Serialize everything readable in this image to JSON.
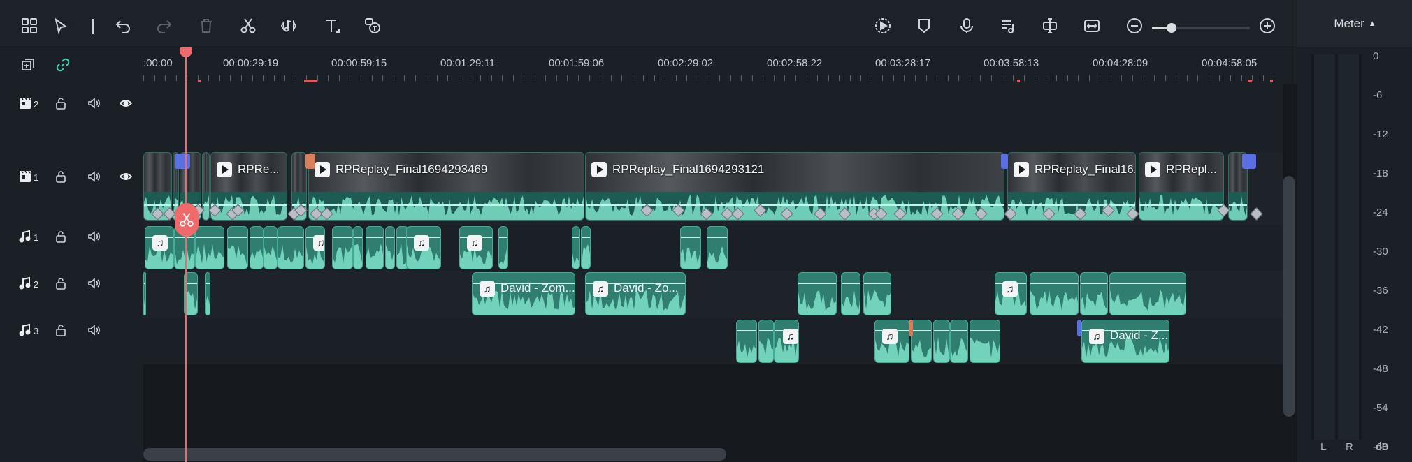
{
  "toolbar": {
    "left_icons": [
      "layout-icon",
      "select-arrow-icon",
      "undo-icon",
      "redo-icon",
      "delete-icon",
      "scissors-icon",
      "audio-beat-icon",
      "text-icon",
      "speech-to-text-icon"
    ],
    "right_icons": [
      "render-preview-icon",
      "marker-icon",
      "microphone-icon",
      "audio-mixer-icon",
      "split-icon",
      "fit-timeline-icon",
      "zoom-out-icon",
      "zoom-in-icon"
    ],
    "zoom_level": 0.2
  },
  "meter": {
    "title": "Meter",
    "scale": [
      "0",
      "-6",
      "-12",
      "-18",
      "-24",
      "-30",
      "-36",
      "-42",
      "-48",
      "-54",
      "-60"
    ],
    "unit": "dB",
    "channels": [
      "L",
      "R"
    ]
  },
  "ruler": {
    "labels": [
      ":00:00",
      "00:00:29:19",
      "00:00:59:15",
      "00:01:29:11",
      "00:01:59:06",
      "00:02:29:02",
      "00:02:58:22",
      "00:03:28:17",
      "00:03:58:13",
      "00:04:28:09",
      "00:04:58:05"
    ]
  },
  "tracks": {
    "video": [
      {
        "number": "2",
        "kind": "video"
      },
      {
        "number": "1",
        "kind": "video"
      }
    ],
    "audio": [
      {
        "number": "1",
        "kind": "audio"
      },
      {
        "number": "2",
        "kind": "audio"
      },
      {
        "number": "3",
        "kind": "audio"
      }
    ]
  },
  "clips": {
    "video1": [
      {
        "title": "RPRe..."
      },
      {
        "title": "RPReplay_Final1694293469"
      },
      {
        "title": "RPReplay_Final1694293121"
      },
      {
        "title": "RPReplay_Final16..."
      },
      {
        "title": "RPRepl..."
      }
    ],
    "audio2": [
      {
        "title": "David - Zom..."
      },
      {
        "title": "David - Zo..."
      }
    ],
    "audio3": [
      {
        "title": "David - Z..."
      }
    ]
  },
  "colors": {
    "playhead": "#f06a6b",
    "clip_green": "#2f7e70",
    "marker_blue": "#5a6fe0",
    "marker_orange": "#d9805b"
  }
}
